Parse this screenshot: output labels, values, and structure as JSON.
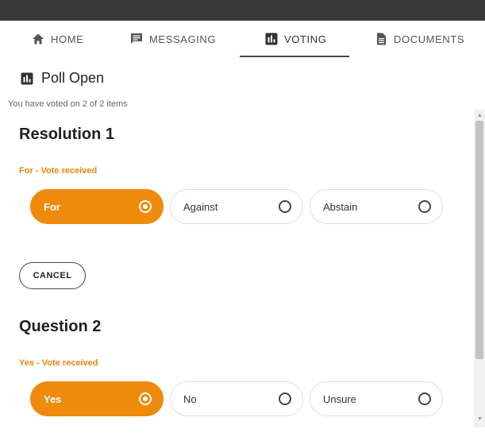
{
  "nav": {
    "tabs": [
      {
        "label": "HOME",
        "icon": "home-icon"
      },
      {
        "label": "MESSAGING",
        "icon": "chat-icon"
      },
      {
        "label": "VOTING",
        "icon": "poll-icon",
        "active": true
      },
      {
        "label": "DOCUMENTS",
        "icon": "document-icon"
      }
    ]
  },
  "poll": {
    "status": "Poll Open",
    "summary": "You have voted on 2 of 2 items"
  },
  "items": [
    {
      "title": "Resolution 1",
      "status": "For - Vote received",
      "options": [
        "For",
        "Against",
        "Abstain"
      ],
      "selected": "For",
      "cancel_label": "CANCEL"
    },
    {
      "title": "Question 2",
      "status": "Yes - Vote received",
      "options": [
        "Yes",
        "No",
        "Unsure"
      ],
      "selected": "Yes"
    }
  ],
  "colors": {
    "accent": "#ee8a0c",
    "status_text": "#e8870c",
    "topbar": "#3a3a3a"
  }
}
